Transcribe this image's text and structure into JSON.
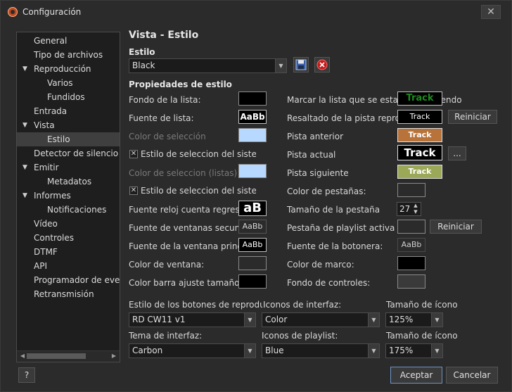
{
  "window": {
    "title": "Configuración",
    "close": "✕"
  },
  "tree": {
    "items": [
      {
        "label": "General"
      },
      {
        "label": "Tipo de archivos"
      },
      {
        "label": "Reproducción",
        "caret": "▼"
      },
      {
        "label": "Varios"
      },
      {
        "label": "Fundidos"
      },
      {
        "label": "Entrada"
      },
      {
        "label": "Vista",
        "caret": "▼"
      },
      {
        "label": "Estilo"
      },
      {
        "label": "Detector de silencio"
      },
      {
        "label": "Emitir",
        "caret": "▼"
      },
      {
        "label": "Metadatos"
      },
      {
        "label": "Informes",
        "caret": "▼"
      },
      {
        "label": "Notificaciones"
      },
      {
        "label": "Vídeo"
      },
      {
        "label": "Controles"
      },
      {
        "label": "DTMF"
      },
      {
        "label": "API"
      },
      {
        "label": "Programador de eventos"
      },
      {
        "label": "Retransmisión"
      }
    ],
    "selected": "Estilo"
  },
  "header": {
    "title": "Vista - Estilo"
  },
  "style": {
    "label": "Estilo",
    "value": "Black",
    "save_icon": "floppy-disk-icon",
    "delete_icon": "delete-circle-icon"
  },
  "props": {
    "heading": "Propiedades de estilo",
    "left": {
      "fondo_lista": "Fondo de la lista:",
      "fuente_lista": "Fuente de lista:",
      "color_seleccion": "Color de selección",
      "estilo_sistema": "Estilo de seleccion del sistema",
      "color_seleccion_listas": "Color de seleccion (listas)",
      "estilo_sistema2": "Estilo de seleccion del sistema",
      "fuente_reloj": "Fuente reloj cuenta regresiva:",
      "fuente_ventanas_sec": "Fuente de ventanas secundarias:",
      "fuente_ventana_princ": "Fuente de la ventana principal:",
      "color_ventana": "Color de ventana:",
      "color_barra": "Color barra ajuste tamaño:"
    },
    "right": {
      "marcar_lista": "Marcar la lista que se esta reproduciendo",
      "resaltado": "Resaltado de la pista reproducida",
      "pista_anterior": "Pista anterior",
      "pista_actual": "Pista actual",
      "pista_siguiente": "Pista siguiente",
      "color_pestanas": "Color de pestañas:",
      "tamano_pestana": "Tamaño de la pestaña",
      "pestana_activa": "Pestaña de playlist activa",
      "fuente_botonera": "Fuente de la botonera:",
      "color_marco": "Color de marco:",
      "fondo_controles": "Fondo de controles:"
    },
    "font_sample": "AaBb",
    "clock_sample": "aB",
    "track": "Track",
    "reiniciar": "Reiniciar",
    "ellipsis": "...",
    "tab_size": "27",
    "checked": "✕"
  },
  "colors": {
    "fondo_lista": "#000000",
    "color_seleccion": "#b7d9ff",
    "color_ventana": "#2b2b2b",
    "color_barra": "#000000",
    "track_marcar_fg": "#1f8a1f",
    "track_anterior_bg": "#b8733a",
    "track_siguiente_bg": "#9aa857",
    "color_pestanas": "#2b2b2b",
    "pestana_activa": "#2b2b2b",
    "color_marco": "#000000",
    "fondo_controles": "#3a3a3a"
  },
  "bottom": {
    "botones_label": "Estilo de los botones de reproducción:",
    "botones_value": "RD CW11 v1",
    "iconos_interfaz_label": "Iconos de interfaz:",
    "iconos_interfaz_value": "Color",
    "tamano_icono_label": "Tamaño de ícono",
    "tamano_icono_value": "125%",
    "tema_label": "Tema de interfaz:",
    "tema_value": "Carbon",
    "iconos_playlist_label": "Iconos de playlist:",
    "iconos_playlist_value": "Blue",
    "tamano_icono2_label": "Tamaño de ícono",
    "tamano_icono2_value": "175%"
  },
  "footer": {
    "help": "?",
    "ok": "Aceptar",
    "cancel": "Cancelar"
  }
}
